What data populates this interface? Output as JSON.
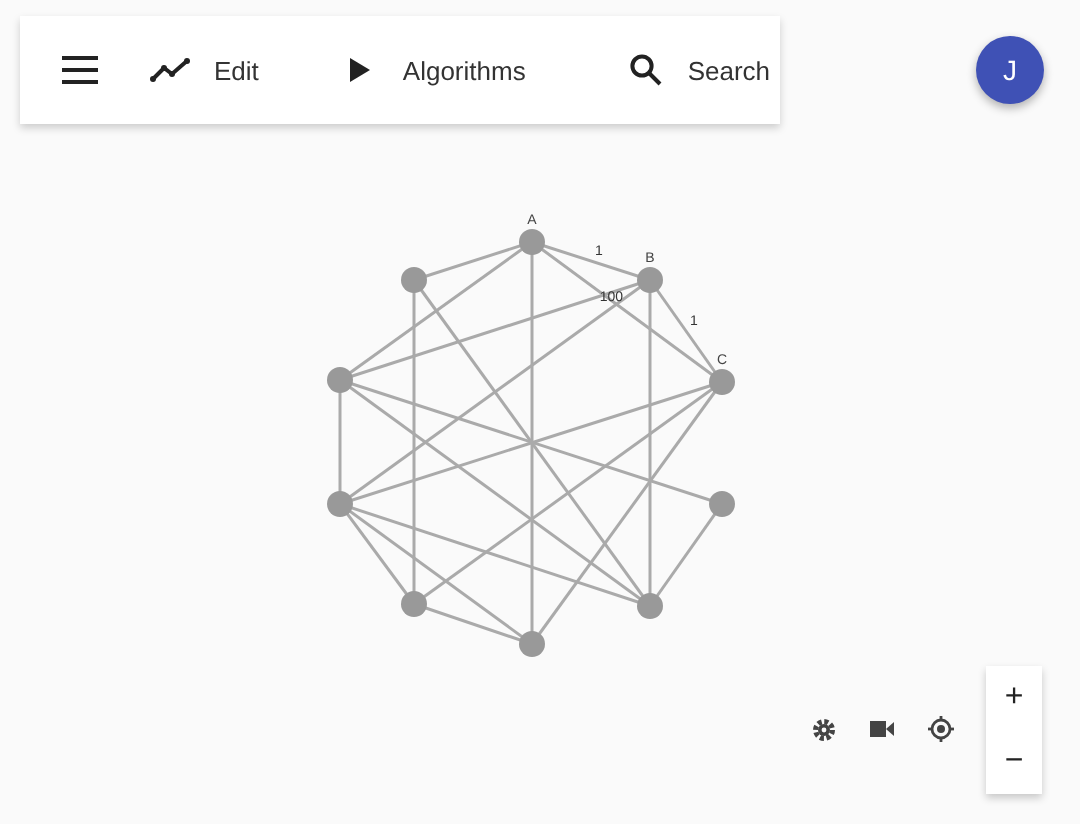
{
  "toolbar": {
    "items": [
      {
        "kind": "edit",
        "label": "Edit"
      },
      {
        "kind": "play",
        "label": "Algorithms"
      },
      {
        "kind": "search",
        "label": "Search"
      }
    ]
  },
  "avatar": {
    "initial": "J"
  },
  "graph": {
    "node_labels": [
      "A",
      "B",
      "C"
    ],
    "edge_weights": [
      "1",
      "100",
      "1"
    ]
  },
  "zoom": {
    "in": "+",
    "out": "−"
  }
}
